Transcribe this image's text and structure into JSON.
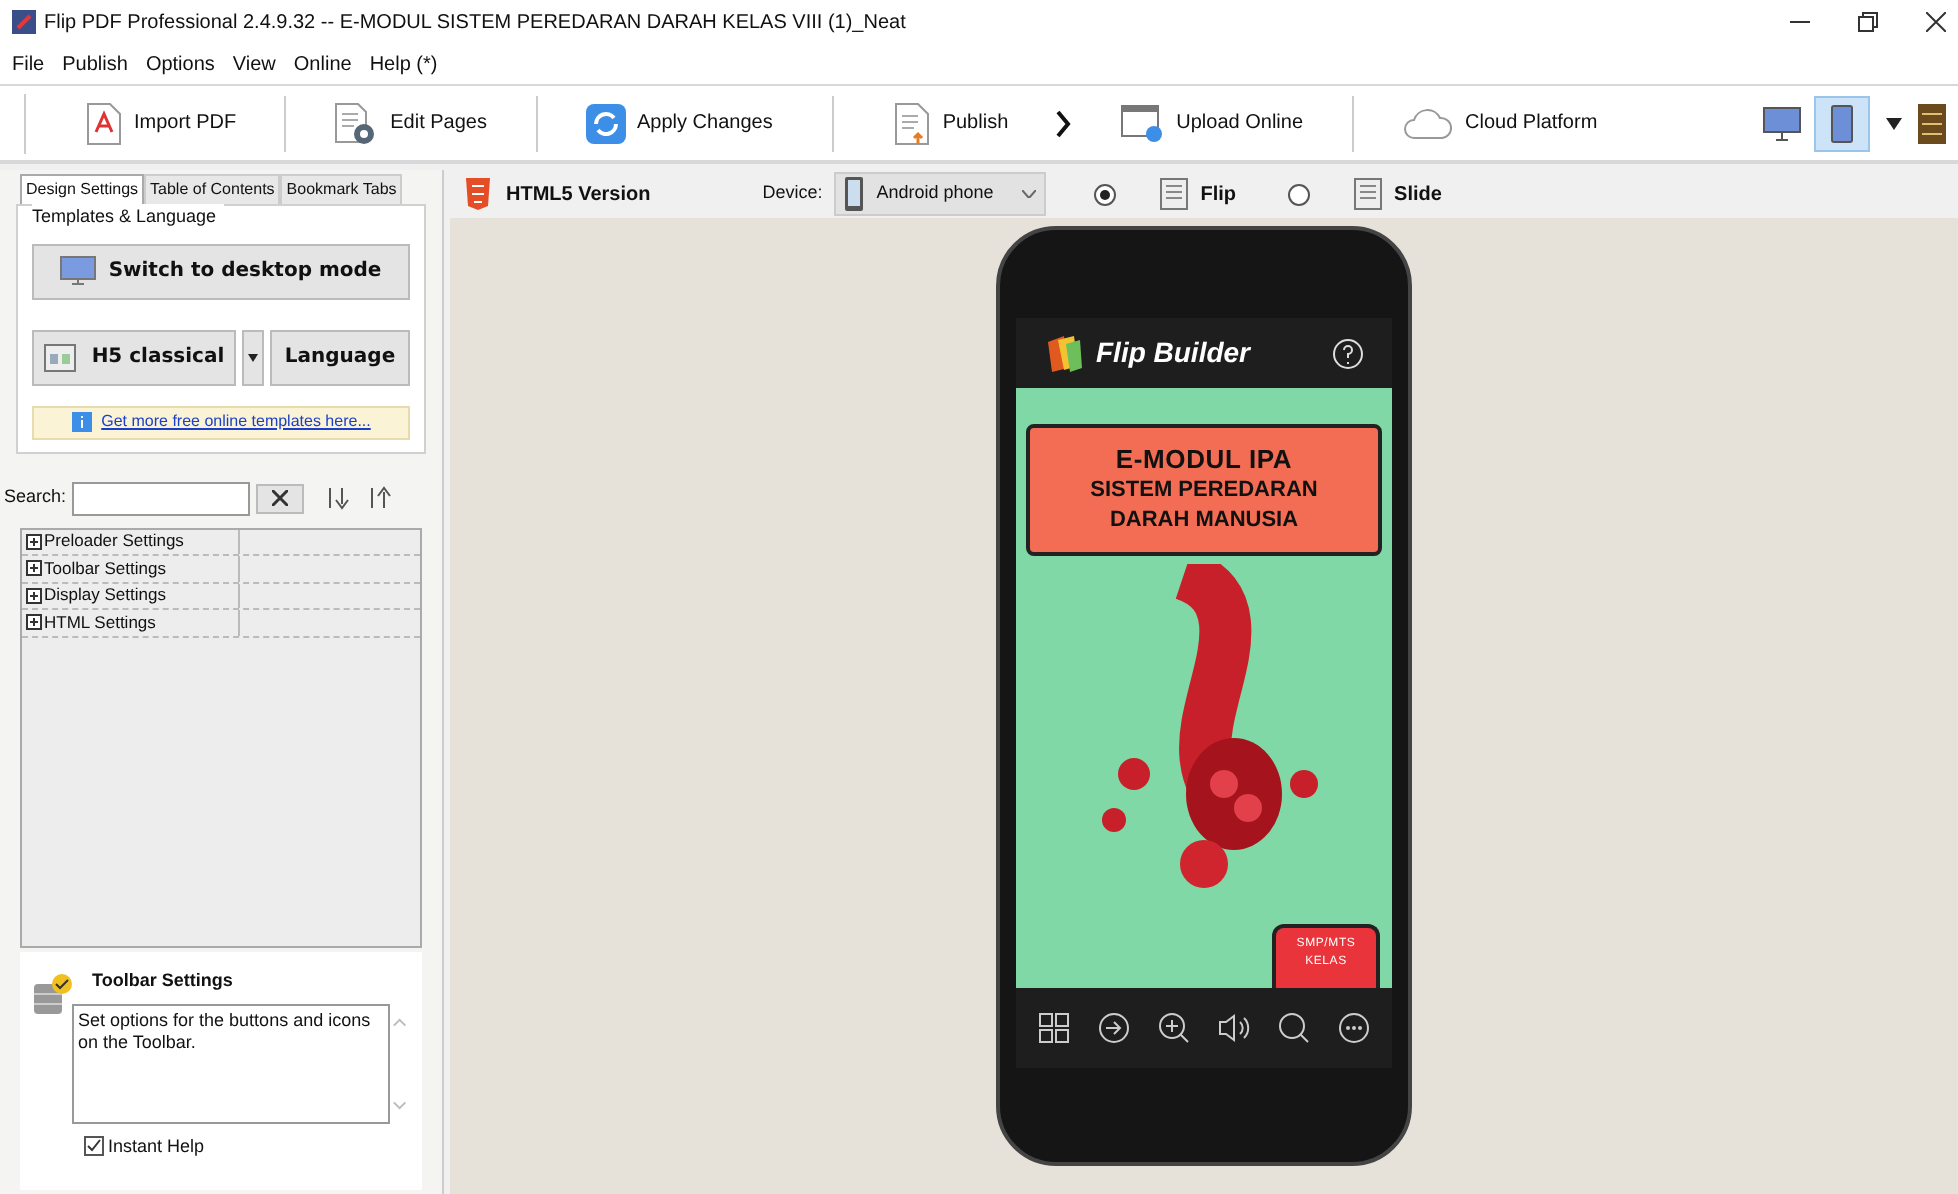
{
  "window": {
    "title": "Flip PDF Professional 2.4.9.32 -- E-MODUL SISTEM PEREDARAN DARAH KELAS VIII (1)_Neat"
  },
  "menu": [
    "File",
    "Publish",
    "Options",
    "View",
    "Online",
    "Help (*)"
  ],
  "toolbar": {
    "buttons": [
      {
        "label": "Import PDF",
        "kind": "pdf"
      },
      {
        "label": "Edit Pages",
        "kind": "edit"
      },
      {
        "label": "Apply Changes",
        "kind": "apply"
      },
      {
        "label": "Publish",
        "kind": "publish"
      },
      {
        "label": "Upload Online",
        "kind": "upload"
      },
      {
        "label": "Cloud Platform",
        "kind": "cloud"
      }
    ],
    "view_modes": [
      {
        "kind": "desktop",
        "selected": false
      },
      {
        "kind": "mobile",
        "selected": true
      }
    ]
  },
  "tabs": [
    {
      "label": "Design Settings",
      "selected": true
    },
    {
      "label": "Table of Contents",
      "selected": false
    },
    {
      "label": "Bookmark Tabs",
      "selected": false
    }
  ],
  "templates": {
    "title": "Templates & Language",
    "switch_button": "Switch to desktop mode",
    "template_button": "H5 classical",
    "language_button": "Language",
    "link": "Get more free online templates here..."
  },
  "search": {
    "label": "Search:"
  },
  "settings_tree": [
    {
      "label": "Preloader Settings",
      "expanded": false
    },
    {
      "label": "Toolbar Settings",
      "expanded": false
    },
    {
      "label": "Display Settings",
      "expanded": false
    },
    {
      "label": "HTML Settings",
      "expanded": false
    }
  ],
  "help": {
    "title": "Toolbar Settings",
    "text": "Set options for the buttons and icons on the Toolbar.",
    "instant_help": {
      "label": "Instant Help",
      "checked": true
    }
  },
  "preview": {
    "title": "HTML5 Version",
    "device_label": "Device:",
    "device": "Android phone",
    "modes": [
      {
        "label": "Flip",
        "selected": true
      },
      {
        "label": "Slide",
        "selected": false
      }
    ],
    "phone": {
      "brand": "Flip Builder",
      "cover_title": "E-MODUL IPA",
      "cover_subtitle": [
        "SISTEM PEREDARAN",
        "DARAH MANUSIA"
      ],
      "badge": [
        "SMP/MTS",
        "KELAS"
      ]
    }
  }
}
